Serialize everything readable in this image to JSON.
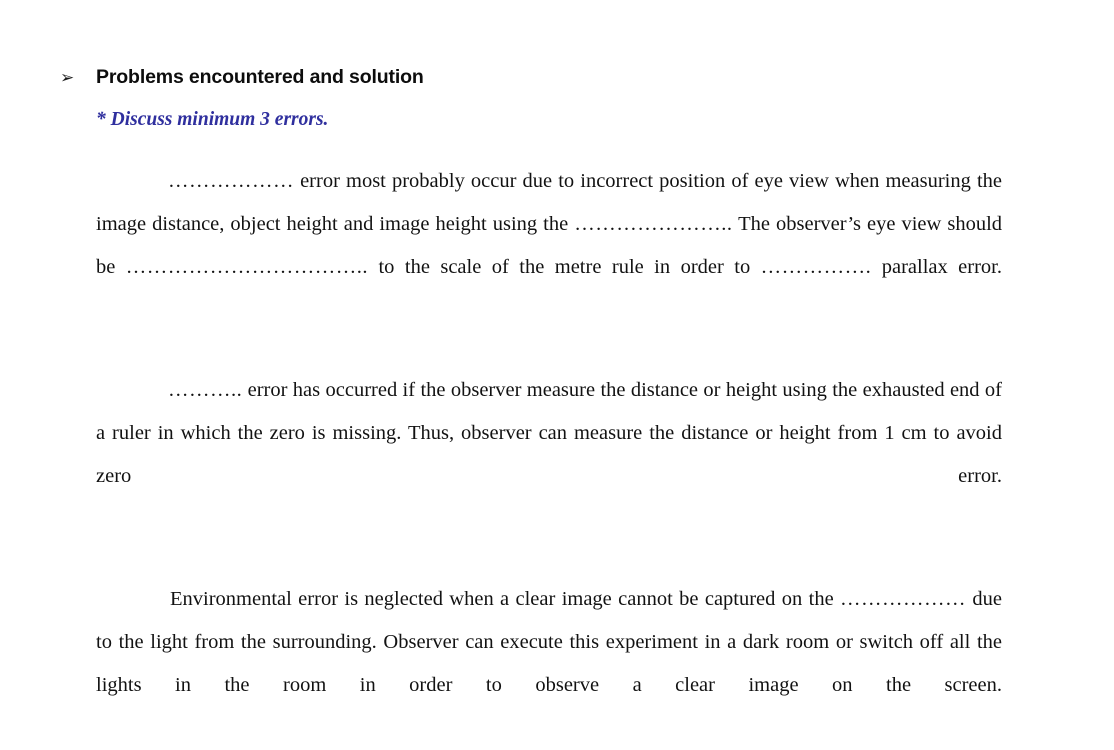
{
  "document": {
    "background_color": "#ffffff",
    "text_color": "#121212",
    "accent_color": "#2f2f9e"
  },
  "heading": {
    "bullet_glyph": "➢",
    "text": "Problems encountered and solution"
  },
  "subnote": {
    "text": "* Discuss minimum 3 errors."
  },
  "paragraphs": [
    {
      "id": "paragraph-parallax-error",
      "segments": [
        {
          "kind": "dots",
          "text": "………………"
        },
        {
          "kind": "text",
          "text": " error most probably occur due to incorrect position of eye view when measuring the image distance, object height and image height using the "
        },
        {
          "kind": "dots",
          "text": "…………………..",
          "trailing_space": true
        },
        {
          "kind": "text",
          "text": " The observer’s eye view should be "
        },
        {
          "kind": "dots",
          "text": "……………………………..",
          "trailing_space": true
        },
        {
          "kind": "text",
          "text": " to the scale of the metre rule in order to "
        },
        {
          "kind": "dots",
          "text": "……………."
        },
        {
          "kind": "text",
          "text": " parallax error."
        }
      ],
      "plain_text": "……………… error most probably occur due to incorrect position of eye view when measuring the image distance, object height and image height using the ………………….. The observer’s eye view should be …………………………….. to the scale of the metre rule in order to ……………. parallax error."
    },
    {
      "id": "paragraph-zero-error",
      "segments": [
        {
          "kind": "dots",
          "text": "……….."
        },
        {
          "kind": "text",
          "text": " error has occurred if the observer measure the distance or height using the exhausted end of a ruler in which the zero is missing. Thus, observer can measure the distance or height from 1 cm to avoid zero error."
        }
      ],
      "plain_text": "……….. error has occurred if the observer measure the distance or height using the exhausted end of a ruler in which the zero is missing. Thus, observer can measure the distance or height from 1 cm to avoid zero error."
    },
    {
      "id": "paragraph-environmental-error",
      "segments": [
        {
          "kind": "text",
          "text": "Environmental error is neglected when a clear image cannot be captured on the "
        },
        {
          "kind": "dots",
          "text": "………………"
        },
        {
          "kind": "text",
          "text": " due to the light from the surrounding. Observer can execute this experiment in a dark room or switch off all the lights in the room in order to observe a clear image on the screen."
        }
      ],
      "plain_text": "Environmental error is neglected when a clear image cannot be captured on the ……………… due to the light from the surrounding. Observer can execute this experiment in a dark room or switch off all the lights in the room in order to observe a clear image on the screen."
    }
  ]
}
